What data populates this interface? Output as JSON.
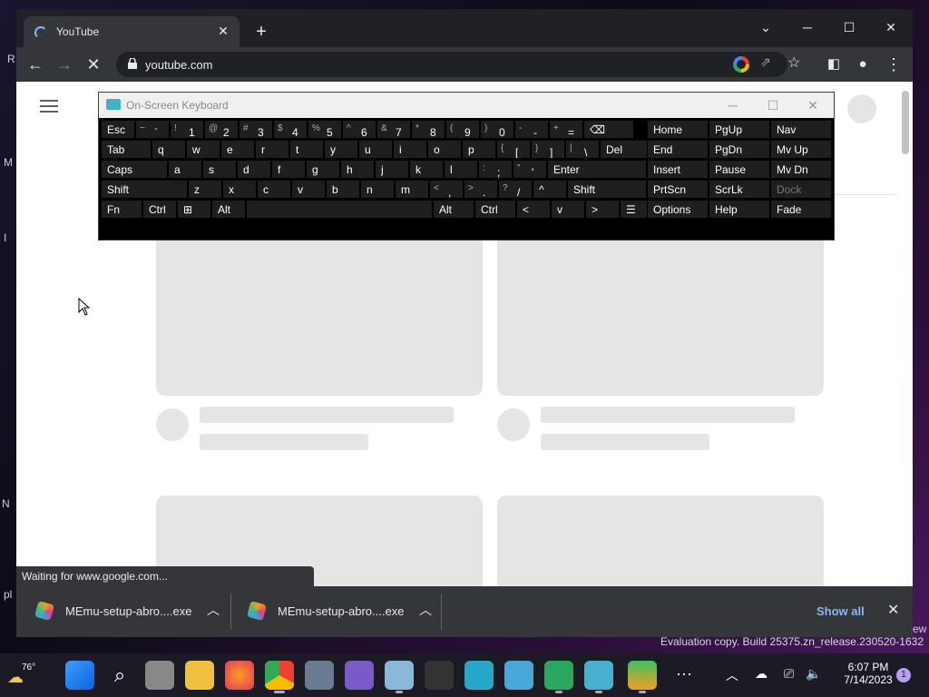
{
  "desktop": {
    "edge_texts": [
      "R",
      "M",
      "I",
      "N",
      "pl",
      "ew"
    ],
    "watermark": "Evaluation copy. Build 25375.zn_release.230520-1632"
  },
  "browser": {
    "tab_title": "YouTube",
    "url": "youtube.com",
    "status_text": "Waiting for www.google.com...",
    "downloads": [
      {
        "name": "MEmu-setup-abro....exe"
      },
      {
        "name": "MEmu-setup-abro....exe"
      }
    ],
    "show_all": "Show all"
  },
  "osk": {
    "title": "On-Screen Keyboard",
    "rows": [
      [
        [
          "Esc",
          "",
          ""
        ],
        [
          "~",
          "`",
          ""
        ],
        [
          "!",
          "1",
          ""
        ],
        [
          "@",
          "2",
          ""
        ],
        [
          "#",
          "3",
          ""
        ],
        [
          "$",
          "4",
          ""
        ],
        [
          "%",
          "5",
          ""
        ],
        [
          "^",
          "6",
          ""
        ],
        [
          "&",
          "7",
          ""
        ],
        [
          "*",
          "8",
          ""
        ],
        [
          "(",
          "9",
          ""
        ],
        [
          ")",
          "0",
          ""
        ],
        [
          "-",
          "-",
          ""
        ],
        [
          "+",
          "=",
          ""
        ],
        [
          "⌫",
          "",
          ""
        ]
      ],
      [
        [
          "Tab",
          "",
          ""
        ],
        [
          "q",
          "",
          ""
        ],
        [
          "w",
          "",
          ""
        ],
        [
          "e",
          "",
          ""
        ],
        [
          "r",
          "",
          ""
        ],
        [
          "t",
          "",
          ""
        ],
        [
          "y",
          "",
          ""
        ],
        [
          "u",
          "",
          ""
        ],
        [
          "i",
          "",
          ""
        ],
        [
          "o",
          "",
          ""
        ],
        [
          "p",
          "",
          ""
        ],
        [
          "{",
          "[",
          ""
        ],
        [
          "}",
          "]",
          ""
        ],
        [
          "|",
          "\\",
          ""
        ],
        [
          "Del",
          "",
          ""
        ]
      ],
      [
        [
          "Caps",
          "",
          ""
        ],
        [
          "a",
          "",
          ""
        ],
        [
          "s",
          "",
          ""
        ],
        [
          "d",
          "",
          ""
        ],
        [
          "f",
          "",
          ""
        ],
        [
          "g",
          "",
          ""
        ],
        [
          "h",
          "",
          ""
        ],
        [
          "j",
          "",
          ""
        ],
        [
          "k",
          "",
          ""
        ],
        [
          "l",
          "",
          ""
        ],
        [
          ":",
          ";",
          ""
        ],
        [
          "\"",
          "'",
          ""
        ],
        [
          "Enter",
          "",
          ""
        ]
      ],
      [
        [
          "Shift",
          "",
          ""
        ],
        [
          "z",
          "",
          ""
        ],
        [
          "x",
          "",
          ""
        ],
        [
          "c",
          "",
          ""
        ],
        [
          "v",
          "",
          ""
        ],
        [
          "b",
          "",
          ""
        ],
        [
          "n",
          "",
          ""
        ],
        [
          "m",
          "",
          ""
        ],
        [
          "<",
          ",",
          ""
        ],
        [
          ">",
          ".",
          ""
        ],
        [
          "?",
          "/",
          ""
        ],
        [
          "^",
          "",
          ""
        ],
        [
          "Shift",
          "",
          ""
        ]
      ],
      [
        [
          "Fn",
          "",
          ""
        ],
        [
          "Ctrl",
          "",
          ""
        ],
        [
          "⊞",
          "",
          ""
        ],
        [
          "Alt",
          "",
          ""
        ],
        [
          "",
          "",
          ""
        ],
        [
          "Alt",
          "",
          ""
        ],
        [
          "Ctrl",
          "",
          ""
        ],
        [
          "<",
          "",
          ""
        ],
        [
          "v",
          "",
          ""
        ],
        [
          ">",
          "",
          ""
        ],
        [
          "☰",
          "",
          ""
        ]
      ]
    ],
    "nav_keys": [
      "Home",
      "PgUp",
      "Nav",
      "End",
      "PgDn",
      "Mv Up",
      "Insert",
      "Pause",
      "Mv Dn",
      "PrtScn",
      "ScrLk",
      "Dock",
      "Options",
      "Help",
      "Fade"
    ]
  },
  "taskbar": {
    "temperature": "76°",
    "time": "6:07 PM",
    "date": "7/14/2023",
    "notification_count": "1"
  }
}
